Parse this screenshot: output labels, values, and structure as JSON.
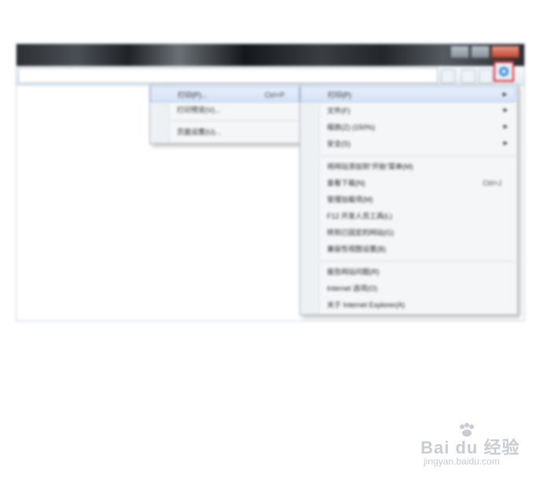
{
  "print_menu": {
    "items": [
      {
        "label": "打印(P)...",
        "shortcut": "Ctrl+P"
      },
      {
        "label": "打印预览(V)..."
      },
      {
        "label": "页面设置(U)..."
      }
    ]
  },
  "tools_menu": {
    "items": [
      {
        "label": "打印(P)",
        "submenu": true
      },
      {
        "label": "文件(F)",
        "submenu": true
      },
      {
        "label": "缩放(Z) (150%)",
        "submenu": true
      },
      {
        "label": "安全(S)",
        "submenu": true
      },
      {
        "label": "将网站添加到“开始”菜单(M)"
      },
      {
        "label": "查看下载(N)",
        "shortcut": "Ctrl+J"
      },
      {
        "label": "管理加载项(M)"
      },
      {
        "label": "F12 开发人员工具(L)"
      },
      {
        "label": "转到已固定的网站(G)"
      },
      {
        "label": "兼容性视图设置(B)"
      },
      {
        "label": "报告网站问题(R)"
      },
      {
        "label": "Internet 选项(O)"
      },
      {
        "label": "关于 Internet Explorer(A)"
      }
    ]
  },
  "watermark": {
    "brand": "Bai du 经验",
    "domain": "jingyan.baidu.com"
  },
  "colors": {
    "highlight_border": "#e2232a",
    "menu_background": "#f4f6f8"
  },
  "icons": {
    "tools_button": "gear-icon",
    "watermark_logo": "paw-icon"
  }
}
